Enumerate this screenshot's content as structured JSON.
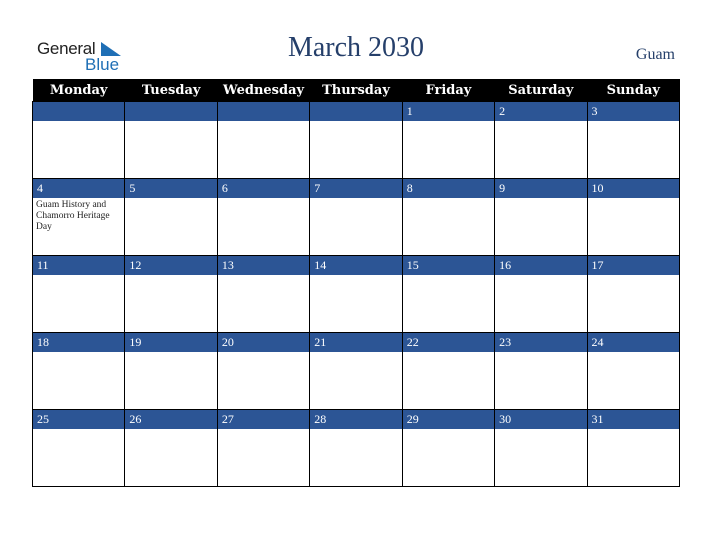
{
  "logo": {
    "word1": "General",
    "word2": "Blue"
  },
  "title": "March 2030",
  "region": "Guam",
  "weekdays": [
    "Monday",
    "Tuesday",
    "Wednesday",
    "Thursday",
    "Friday",
    "Saturday",
    "Sunday"
  ],
  "weeks": [
    [
      {
        "day": ""
      },
      {
        "day": ""
      },
      {
        "day": ""
      },
      {
        "day": ""
      },
      {
        "day": "1"
      },
      {
        "day": "2"
      },
      {
        "day": "3"
      }
    ],
    [
      {
        "day": "4",
        "event": "Guam History and Chamorro Heritage Day"
      },
      {
        "day": "5"
      },
      {
        "day": "6"
      },
      {
        "day": "7"
      },
      {
        "day": "8"
      },
      {
        "day": "9"
      },
      {
        "day": "10"
      }
    ],
    [
      {
        "day": "11"
      },
      {
        "day": "12"
      },
      {
        "day": "13"
      },
      {
        "day": "14"
      },
      {
        "day": "15"
      },
      {
        "day": "16"
      },
      {
        "day": "17"
      }
    ],
    [
      {
        "day": "18"
      },
      {
        "day": "19"
      },
      {
        "day": "20"
      },
      {
        "day": "21"
      },
      {
        "day": "22"
      },
      {
        "day": "23"
      },
      {
        "day": "24"
      }
    ],
    [
      {
        "day": "25"
      },
      {
        "day": "26"
      },
      {
        "day": "27"
      },
      {
        "day": "28"
      },
      {
        "day": "29"
      },
      {
        "day": "30"
      },
      {
        "day": "31"
      }
    ]
  ],
  "colors": {
    "header_bg": "#000000",
    "day_band": "#2c5595",
    "title": "#253f6a",
    "logo_blue": "#1f6fb5"
  }
}
